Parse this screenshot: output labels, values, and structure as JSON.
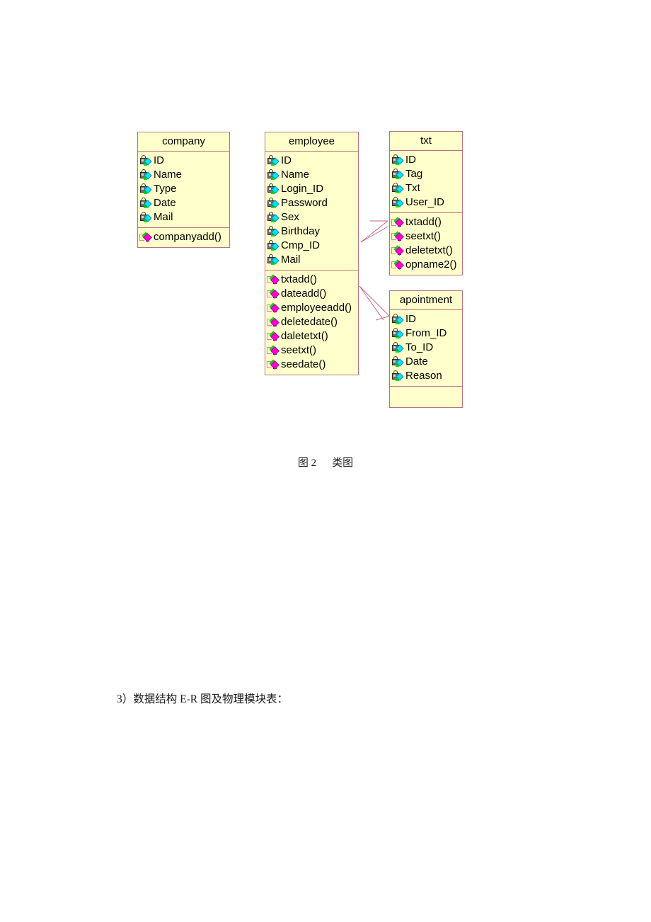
{
  "document": {
    "figure_caption_number": "图 2",
    "figure_caption_title": "类图",
    "body_text": "3）数据结构 E-R 图及物理模块表："
  },
  "diagram": {
    "type": "uml-class-diagram",
    "colors": {
      "class_fill": "#ffffcc",
      "class_border": "#b5737f",
      "connector": "#c06a86",
      "attribute_marker": "#00e5ff",
      "operation_marker": "#ff00d0"
    },
    "classes": [
      {
        "id": "company",
        "name": "company",
        "attributes": [
          "ID",
          "Name",
          "Type",
          "Date",
          "Mail"
        ],
        "operations": [
          "companyadd()"
        ]
      },
      {
        "id": "employee",
        "name": "employee",
        "attributes": [
          "ID",
          "Name",
          "Login_ID",
          "Password",
          "Sex",
          "Birthday",
          "Cmp_ID",
          "Mail"
        ],
        "operations": [
          "txtadd()",
          "dateadd()",
          "employeeadd()",
          "deletedate()",
          "daletetxt()",
          "seetxt()",
          "seedate()"
        ]
      },
      {
        "id": "txt",
        "name": "txt",
        "attributes": [
          "ID",
          "Tag",
          "Txt",
          "User_ID"
        ],
        "operations": [
          "txtadd()",
          "seetxt()",
          "deletetxt()",
          "opname2()"
        ]
      },
      {
        "id": "apointment",
        "name": "apointment",
        "attributes": [
          "ID",
          "From_ID",
          "To_ID",
          "Date",
          "Reason"
        ],
        "operations": []
      }
    ],
    "connectors": [
      {
        "id": "employee-to-txt",
        "from": "employee",
        "to": "txt",
        "style": "association-arrow"
      },
      {
        "id": "employee-to-apointment",
        "from": "employee",
        "to": "apointment",
        "style": "association-arrow"
      }
    ]
  }
}
